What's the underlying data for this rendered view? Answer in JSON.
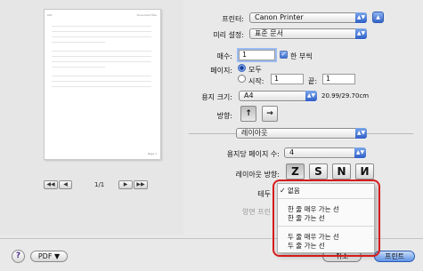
{
  "preview": {
    "page_header_left": "001",
    "page_header_right": "Document title",
    "page_footer": "Page 1",
    "nav_first": "◀◀",
    "nav_prev": "◀",
    "nav_next": "▶",
    "nav_last": "▶▶",
    "page_count": "1/1"
  },
  "printer": {
    "label": "프린터:",
    "value": "Canon Printer",
    "warning_icon": "eject-icon"
  },
  "presets": {
    "label": "미리 설정:",
    "value": "표준 문서"
  },
  "copies": {
    "label": "매수:",
    "value": "1",
    "collate_label": "한 부씩",
    "collate_checked": true
  },
  "pages": {
    "label": "페이지:",
    "all_label": "모두",
    "from_label": "시작:",
    "from_value": "1",
    "to_label": "끝:",
    "to_value": "1",
    "selected": "all"
  },
  "paper_size": {
    "label": "용지 크기:",
    "value": "A4",
    "dimensions": "20.99/29.70cm"
  },
  "orientation": {
    "label": "방향:",
    "selected": "portrait"
  },
  "section": {
    "value": "레이아웃"
  },
  "pages_per_sheet": {
    "label": "용지당 페이지 수:",
    "value": "4"
  },
  "layout_direction": {
    "label": "레이아웃 방향:",
    "options": [
      "Z",
      "S",
      "N",
      "И"
    ],
    "selected_index": 0
  },
  "border": {
    "label": "테두",
    "hidden_label": "양면 프린"
  },
  "border_menu": {
    "items": [
      {
        "label": "없음",
        "checked": true
      },
      {
        "label": "한 줄 매우 가는 선",
        "checked": false
      },
      {
        "label": "한 줄 가는 선",
        "checked": false
      },
      {
        "label": "두 줄 매우 가는 선",
        "checked": false
      },
      {
        "label": "두 줄 가는 선",
        "checked": false
      }
    ]
  },
  "footer": {
    "help": "?",
    "pdf": "PDF ▼",
    "cancel": "취소",
    "print": "프린트"
  },
  "colors": {
    "accent": "#3b6fd2",
    "highlight": "#d61b1b"
  }
}
